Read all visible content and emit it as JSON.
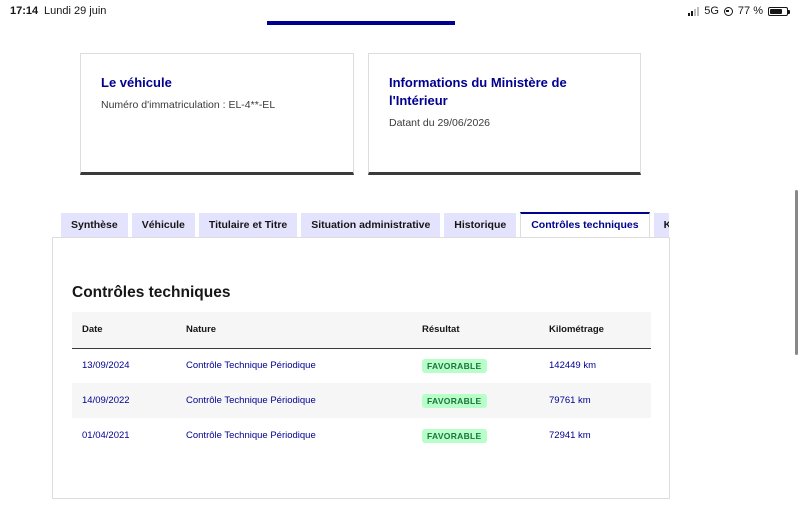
{
  "status": {
    "time": "17:14",
    "date": "Lundi 29 juin",
    "network": "5G",
    "battery": "77 %",
    "battery_level": 0.77
  },
  "cards": {
    "vehicle": {
      "title": "Le véhicule",
      "desc": "Numéro d'immatriculation : EL-4**-EL"
    },
    "ministry": {
      "title": "Informations du Ministère de l'Intérieur",
      "desc": "Datant du 29/06/2026"
    }
  },
  "tabs": [
    {
      "label": "Synthèse"
    },
    {
      "label": "Véhicule"
    },
    {
      "label": "Titulaire et Titre"
    },
    {
      "label": "Situation administrative"
    },
    {
      "label": "Historique"
    },
    {
      "label": "Contrôles techniques"
    },
    {
      "label": "Kilométrage"
    }
  ],
  "active_tab": "Contrôles techniques",
  "section": {
    "title": "Contrôles techniques",
    "columns": [
      "Date",
      "Nature",
      "Résultat",
      "Kilométrage"
    ],
    "rows": [
      {
        "date": "13/09/2024",
        "nature": "Contrôle Technique Périodique",
        "result": "FAVORABLE",
        "km": "142449 km"
      },
      {
        "date": "14/09/2022",
        "nature": "Contrôle Technique Périodique",
        "result": "FAVORABLE",
        "km": "79761 km"
      },
      {
        "date": "01/04/2021",
        "nature": "Contrôle Technique Périodique",
        "result": "FAVORABLE",
        "km": "72941 km"
      }
    ]
  },
  "colors": {
    "primary": "#000091",
    "tab_bg": "#e3e3fd",
    "success_bg": "#b8fec9",
    "success_text": "#18753c"
  }
}
